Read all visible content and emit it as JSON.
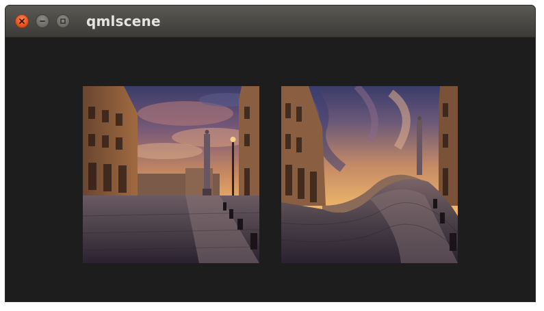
{
  "window": {
    "title": "qmlscene",
    "controls": {
      "close_icon": "close-icon",
      "minimize_icon": "minimize-icon",
      "maximize_icon": "maximize-icon"
    }
  },
  "content": {
    "background": "#1d1d1d",
    "images": [
      {
        "name": "original-photo",
        "description_icon": "city-square-photo"
      },
      {
        "name": "wave-distorted-photo",
        "description_icon": "city-square-photo-wave-effect"
      }
    ]
  },
  "colors": {
    "close_button": "#e9541f",
    "titlebar": "#4b4a46",
    "title_text": "#e5e4e1"
  }
}
